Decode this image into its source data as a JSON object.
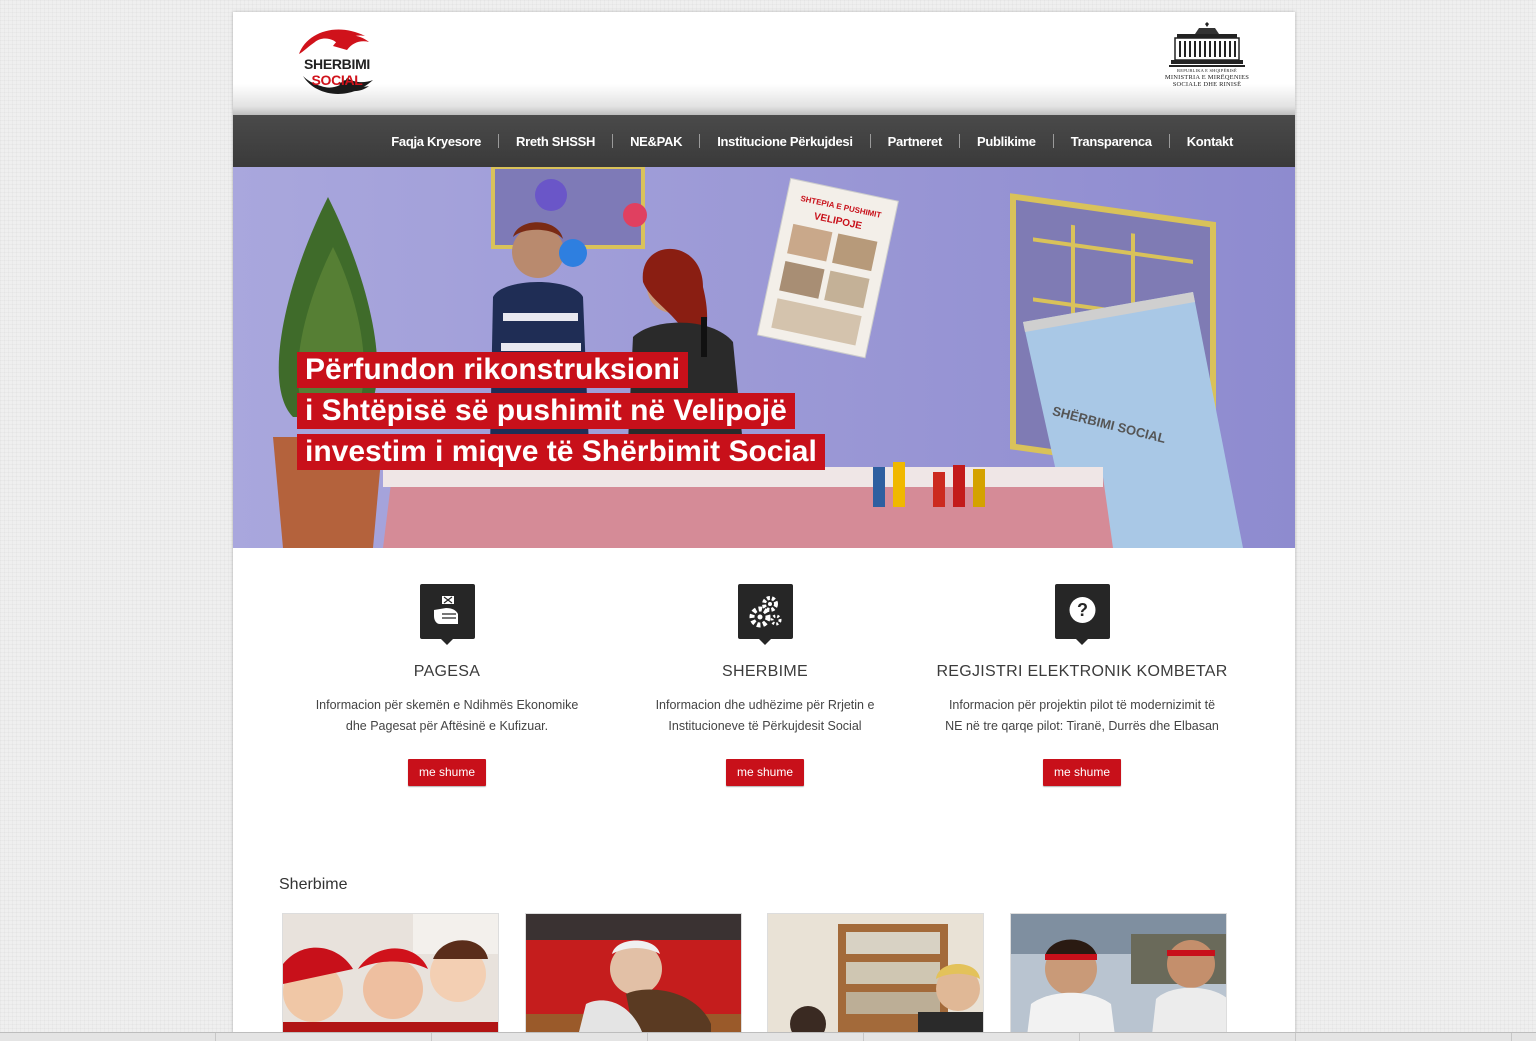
{
  "header": {
    "logo": {
      "word1": "SHERBIMI",
      "word2": "SOCIAL",
      "brand_color": "#d0121b"
    },
    "ministry": {
      "line1": "Republika e Shqipërisë",
      "line2": "Ministria e Mirëqenies",
      "line3": "Sociale dhe Rinisë"
    }
  },
  "nav": {
    "items": [
      {
        "label": "Faqja Kryesore"
      },
      {
        "label": "Rreth SHSSH"
      },
      {
        "label": "NE&PAK"
      },
      {
        "label": "Institucione Përkujdesi"
      },
      {
        "label": "Partneret"
      },
      {
        "label": "Publikime"
      },
      {
        "label": "Transparenca"
      },
      {
        "label": "Kontakt"
      }
    ]
  },
  "hero": {
    "caption_lines": [
      "Përfundon rikonstruksioni",
      "i Shtëpisë së pushimit në Velipojë",
      "investim i miqve të Shërbimit Social"
    ],
    "poster_text": "SHTEPIA E PUSHIMIT VELIPOJE",
    "banner_text": "SHËRBIMI SOCIAL",
    "accent_color": "#c8101a"
  },
  "features": [
    {
      "icon": "hand-money-icon",
      "title": "PAGESA",
      "text_line1": "Informacion për skemën e Ndihmës Ekonomike",
      "text_line2": "dhe Pagesat për Aftësinë e Kufizuar.",
      "button": "me shume"
    },
    {
      "icon": "gears-icon",
      "title": "SHERBIME",
      "text_line1": "Informacion dhe udhëzime për Rrjetin e",
      "text_line2": "Institucioneve të Përkujdesit Social",
      "button": "me shume"
    },
    {
      "icon": "question-icon",
      "title": "REGJISTRI ELEKTRONIK KOMBETAR",
      "text_line1": "Informacion për projektin pilot të modernizimit të",
      "text_line2": "NE në tre qarqe pilot: Tiranë, Durrës dhe Elbasan",
      "button": "me shume"
    }
  ],
  "services": {
    "title": "Sherbime",
    "items": [
      {
        "image": "children-in-costumes-photo"
      },
      {
        "image": "elderly-man-hug-photo"
      },
      {
        "image": "classroom-photo"
      },
      {
        "image": "boys-with-headbands-photo"
      }
    ]
  }
}
